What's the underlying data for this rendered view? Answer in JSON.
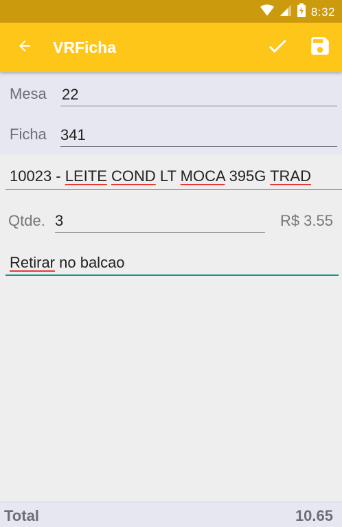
{
  "status_bar": {
    "time": "8:32",
    "icons": [
      "wifi-icon",
      "cell-signal-icon",
      "battery-charging-icon"
    ]
  },
  "app_bar": {
    "title": "VRFicha",
    "back_icon": "arrow-left-icon",
    "confirm_icon": "check-icon",
    "save_icon": "floppy-disk-icon",
    "color": "#ffc61a"
  },
  "header": {
    "mesa_label": "Mesa",
    "mesa_value": "22",
    "ficha_label": "Ficha",
    "ficha_value": "341"
  },
  "product": {
    "code_prefix": "10023 - ",
    "word1": "LEITE",
    "word2": "COND",
    "word3": " LT ",
    "word4": "MOCA",
    "word5": " 395G ",
    "word6": "TRAD"
  },
  "quantity": {
    "label": "Qtde.",
    "value": "3",
    "price": "R$ 3.55"
  },
  "observation": {
    "word1": "Retirar",
    "rest": " no balcao"
  },
  "footer": {
    "total_label": "Total",
    "total_value": "10.65"
  }
}
